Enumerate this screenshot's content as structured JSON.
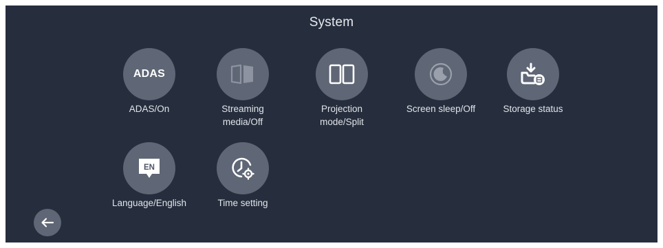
{
  "header": {
    "title": "System"
  },
  "tiles": [
    {
      "icon": "adas-icon",
      "icon_text": "ADAS",
      "label": "ADAS/On"
    },
    {
      "icon": "streaming-media-icon",
      "label": "Streaming\nmedia/Off"
    },
    {
      "icon": "projection-split-icon",
      "label": "Projection\nmode/Split"
    },
    {
      "icon": "screen-sleep-icon",
      "label": "Screen sleep/Off"
    },
    {
      "icon": "storage-status-icon",
      "label": "Storage status"
    },
    {
      "icon": "language-icon",
      "icon_text": "EN",
      "label": "Language/English"
    },
    {
      "icon": "time-setting-icon",
      "label": "Time setting"
    }
  ],
  "footer": {
    "back_icon": "back-arrow-icon"
  },
  "colors": {
    "background": "#262e3e",
    "tile_circle": "#5f6675",
    "text": "#e2e5ea"
  }
}
